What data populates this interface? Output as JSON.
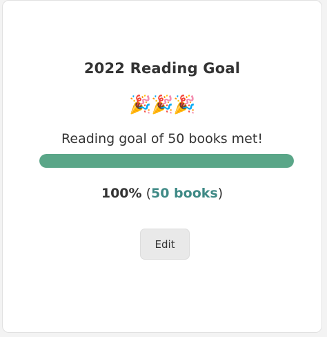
{
  "card": {
    "title": "2022 Reading Goal",
    "celebration_emoji": "🎉",
    "message": "Reading goal of 50 books met!",
    "progress": {
      "percent": 100,
      "percent_label": "100%",
      "books_label": "50 books",
      "fill_color": "#5aa688"
    },
    "edit_label": "Edit"
  }
}
